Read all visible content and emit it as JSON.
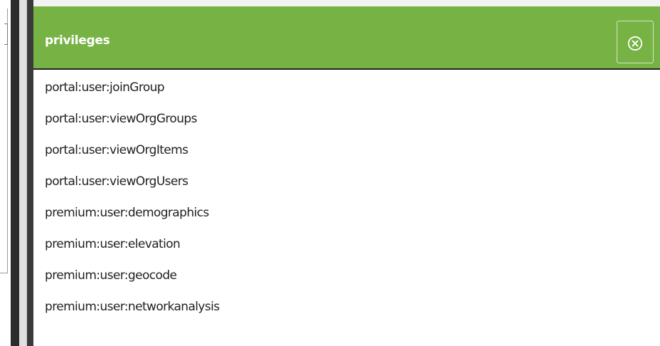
{
  "dialog": {
    "title": "privileges",
    "close_icon": "close-circle-icon",
    "accent_color": "#77b244"
  },
  "privileges": [
    "portal:user:joinGroup",
    "portal:user:viewOrgGroups",
    "portal:user:viewOrgItems",
    "portal:user:viewOrgUsers",
    "premium:user:demographics",
    "premium:user:elevation",
    "premium:user:geocode",
    "premium:user:networkanalysis"
  ]
}
